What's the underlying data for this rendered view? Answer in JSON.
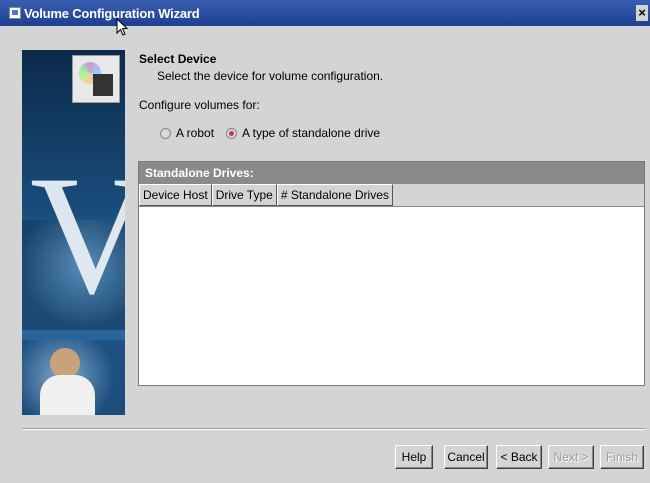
{
  "window": {
    "title": "Volume Configuration Wizard",
    "close_glyph": "×"
  },
  "step": {
    "heading": "Select Device",
    "description": "Select the device for volume configuration."
  },
  "configure": {
    "label": "Configure volumes for:",
    "options": [
      {
        "label": "A robot",
        "checked": false
      },
      {
        "label": "A type of standalone drive",
        "checked": true
      }
    ]
  },
  "table": {
    "title": "Standalone Drives:",
    "columns": [
      "Device Host",
      "Drive Type",
      "# Standalone Drives"
    ],
    "rows": []
  },
  "buttons": {
    "help": "Help",
    "cancel": "Cancel",
    "back": "< Back",
    "next": "Next >",
    "finish": "Finish"
  },
  "colors": {
    "titlebar": "#2a4fa0",
    "radio_selected": "#d0306a"
  }
}
